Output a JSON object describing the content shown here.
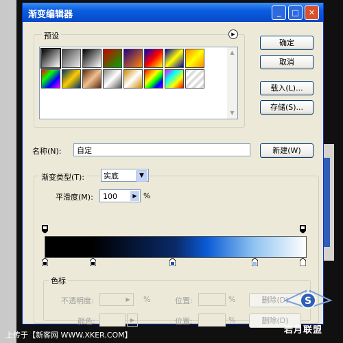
{
  "window": {
    "title": "渐变编辑器"
  },
  "presets": {
    "label": "预设"
  },
  "buttons": {
    "ok": "确定",
    "cancel": "取消",
    "load": "载入(L)...",
    "save": "存储(S)...",
    "new": "新建(W)"
  },
  "name": {
    "label": "名称(N):",
    "value": "自定"
  },
  "gradient": {
    "type_label": "渐变类型(T):",
    "type_value": "实底",
    "smooth_label": "平滑度(M):",
    "smooth_value": "100",
    "percent": "%"
  },
  "stops": {
    "group_label": "色标",
    "opacity_label": "不透明度:",
    "color_label": "颜色:",
    "position_label": "位置:",
    "delete_label": "删除(D)",
    "percent": "%"
  },
  "footer": {
    "text": "上传于【新客网 WWW.XKER.COM】",
    "watermark": "岩月联盟"
  },
  "colors": {
    "title_bar": "#0a5ee0",
    "dialog": "#ece9d8"
  }
}
